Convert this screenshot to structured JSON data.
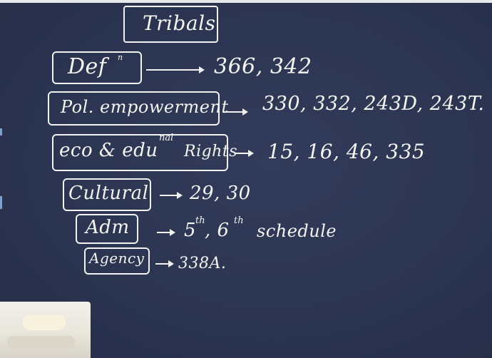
{
  "title": "Tribals",
  "rows": [
    {
      "label": "Def",
      "label_sup": "n",
      "value": "366, 342"
    },
    {
      "label": "Pol. empowerment",
      "value": "330, 332, 243D, 243T."
    },
    {
      "label": "eco & edu",
      "label_sup": "nal",
      "label_suffix": "Rights",
      "value": "15, 16, 46, 335"
    },
    {
      "label": "Cultural",
      "value": "29, 30"
    },
    {
      "label": "Adm",
      "value": "5",
      "value_sup": "th",
      "value_mid": ", 6",
      "value_sup2": "th",
      "value_suffix": "schedule"
    },
    {
      "label": "Agency",
      "value": "338A."
    }
  ]
}
